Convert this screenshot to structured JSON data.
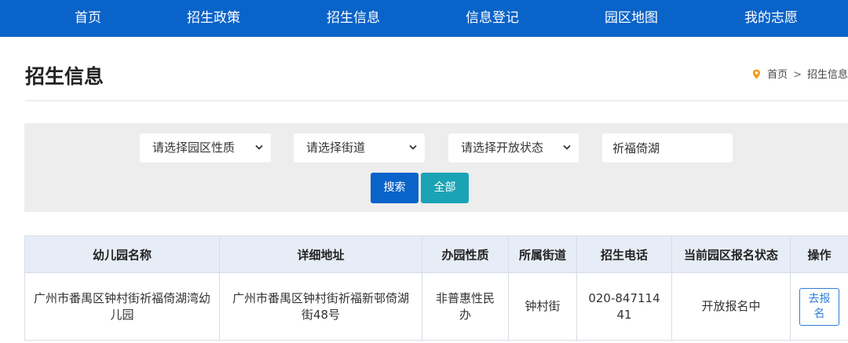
{
  "nav": {
    "items": [
      "首页",
      "招生政策",
      "招生信息",
      "信息登记",
      "园区地图",
      "我的志愿"
    ]
  },
  "page": {
    "title": "招生信息",
    "breadcrumb": {
      "home": "首页",
      "separator": ">",
      "current": "招生信息"
    }
  },
  "filters": {
    "nature_select": "请选择园区性质",
    "street_select": "请选择街道",
    "status_select": "请选择开放状态",
    "keyword_value": "祈福倚湖",
    "search_label": "搜索",
    "all_label": "全部"
  },
  "table": {
    "headers": [
      "幼儿园名称",
      "详细地址",
      "办园性质",
      "所属街道",
      "招生电话",
      "当前园区报名状态",
      "操作"
    ],
    "rows": [
      {
        "name": "广州市番禺区钟村街祈福倚湖湾幼儿园",
        "address": "广州市番禺区钟村街祈福新邨倚湖街48号",
        "nature": "非普惠性民办",
        "street": "钟村街",
        "phone": "020-84711441",
        "status": "开放报名中",
        "action": "去报名"
      }
    ]
  },
  "colors": {
    "nav_bg": "#0a63c8",
    "search_button": "#0a63c8",
    "all_button": "#1aa3b4",
    "pin_icon": "#f29a1f",
    "action_link": "#2f7ed8",
    "table_header_bg": "#e7edf6"
  },
  "icons": {
    "breadcrumb": "location-pin-icon",
    "select": "chevron-down-icon"
  }
}
